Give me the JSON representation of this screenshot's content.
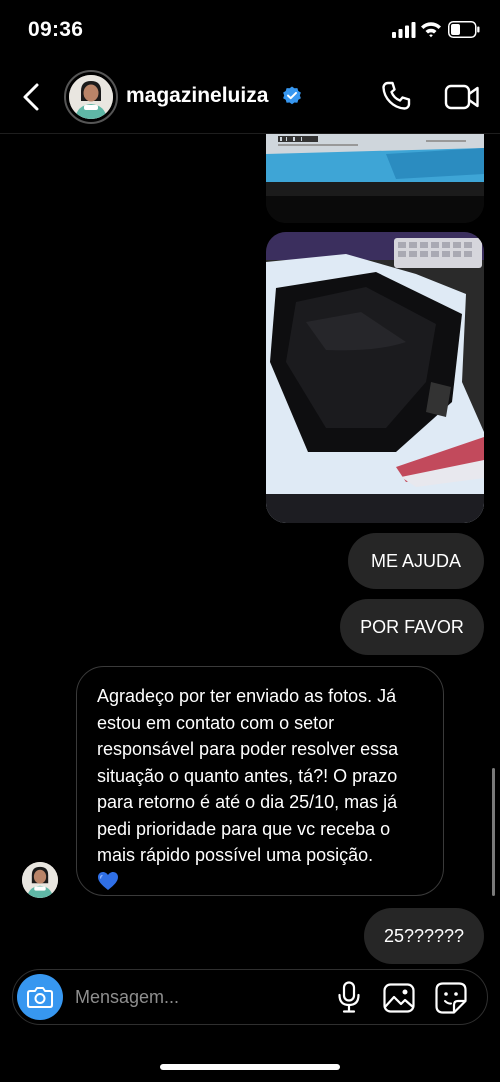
{
  "status_bar": {
    "time": "09:36"
  },
  "header": {
    "username": "magazineluiza"
  },
  "messages": {
    "out_1": "ME AJUDA",
    "out_2": "POR FAVOR",
    "in_1": "Agradeço por ter enviado as fotos. Já estou em contato com o setor responsável para poder resolver essa situação o quanto antes, tá?! O prazo para retorno é até o dia 25/10, mas já pedi prioridade para que vc receba o mais rápido possível uma posição.",
    "out_3": "25??????"
  },
  "composer": {
    "placeholder": "Mensagem..."
  },
  "colors": {
    "accent": "#3797f0",
    "bubble_out": "#262626",
    "background": "#000000"
  },
  "icons": [
    "back-chevron-icon",
    "verified-badge-icon",
    "phone-icon",
    "video-camera-icon",
    "camera-icon",
    "microphone-icon",
    "gallery-icon",
    "sticker-icon",
    "blue-heart-icon"
  ]
}
